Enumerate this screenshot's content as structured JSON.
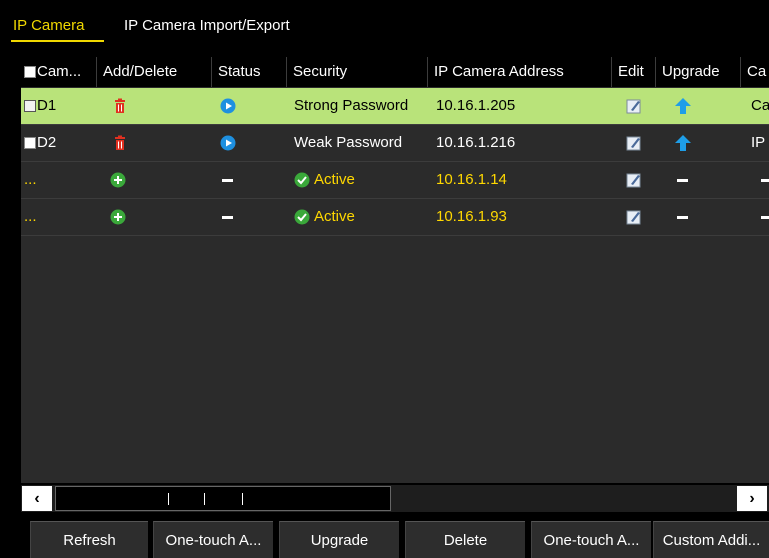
{
  "tabs": [
    {
      "label": "IP Camera",
      "active": true
    },
    {
      "label": "IP Camera Import/Export",
      "active": false
    }
  ],
  "table": {
    "columns": [
      "Cam...",
      "Add/Delete",
      "Status",
      "Security",
      "IP Camera Address",
      "Edit",
      "Upgrade",
      "Ca"
    ],
    "rows": [
      {
        "camera": "D1",
        "add_delete": "delete-icon",
        "status": "play-icon",
        "security": "Strong Password",
        "address": "10.16.1.205",
        "edit": "edit-icon",
        "upgrade": "upgrade-icon",
        "ca": "Ca",
        "selected": true,
        "discovered": false
      },
      {
        "camera": "D2",
        "add_delete": "delete-icon",
        "status": "play-icon",
        "security": "Weak Password",
        "address": "10.16.1.216",
        "edit": "edit-icon",
        "upgrade": "upgrade-icon",
        "ca": "IP",
        "selected": false,
        "discovered": false
      },
      {
        "camera": "...",
        "add_delete": "add-icon",
        "status": "—",
        "security": "Active",
        "address": "10.16.1.14",
        "edit": "edit-icon",
        "upgrade": "—",
        "ca": "—",
        "selected": false,
        "discovered": true
      },
      {
        "camera": "...",
        "add_delete": "add-icon",
        "status": "—",
        "security": "Active",
        "address": "10.16.1.93",
        "edit": "edit-icon",
        "upgrade": "—",
        "ca": "—",
        "selected": false,
        "discovered": true
      }
    ]
  },
  "scrollbar": {
    "left_arrow": "‹",
    "right_arrow": "›"
  },
  "buttons": [
    {
      "label": "Refresh"
    },
    {
      "label": "One-touch A..."
    },
    {
      "label": "Upgrade"
    },
    {
      "label": "Delete"
    },
    {
      "label": "One-touch A..."
    },
    {
      "label": "Custom Addi..."
    }
  ],
  "colors": {
    "accent_yellow": "#f0d800",
    "selected_row": "#b9e37a",
    "delete_red": "#e03020",
    "add_green": "#3aa83a",
    "status_blue": "#1e90e0",
    "upgrade_blue": "#1e9ee8"
  }
}
